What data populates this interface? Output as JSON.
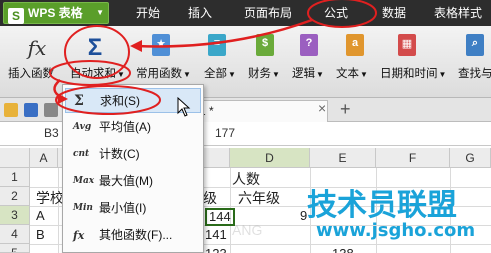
{
  "app": {
    "name": "WPS 表格",
    "logo": "S"
  },
  "menu": {
    "tabs": [
      "开始",
      "插入",
      "页面布局",
      "公式",
      "数据",
      "表格样式"
    ],
    "active": "公式"
  },
  "ribbon": {
    "buttons": [
      {
        "id": "insert-func",
        "label": "插入函数",
        "icon": "fx"
      },
      {
        "id": "autosum",
        "label": "自动求和",
        "icon": "Σ"
      },
      {
        "id": "common",
        "label": "常用函数"
      },
      {
        "id": "all",
        "label": "全部"
      },
      {
        "id": "finance",
        "label": "财务",
        "icon": "$"
      },
      {
        "id": "logic",
        "label": "逻辑",
        "icon": "?"
      },
      {
        "id": "text",
        "label": "文本",
        "icon": "a"
      },
      {
        "id": "datetime",
        "label": "日期和时间"
      },
      {
        "id": "lookup",
        "label": "查找与"
      }
    ]
  },
  "tabs_row": {
    "doc_tab": "x1 *",
    "plus": "+"
  },
  "formula_bar": {
    "cell_ref": "B3",
    "value": "177"
  },
  "grid": {
    "columns": [
      "A",
      "B",
      "C",
      "D",
      "E",
      "F",
      "G"
    ],
    "rows": [
      "1",
      "2",
      "3",
      "4",
      "5"
    ],
    "cells": {
      "a2": "学校",
      "a3": "A",
      "a4": "B",
      "c2": "级",
      "c3": "144",
      "c4": "141",
      "c5": "123",
      "d1": "人数",
      "d2": "六年级",
      "d3": "9",
      "e5": "138"
    }
  },
  "dropdown": {
    "items": [
      {
        "icon": "Σ",
        "label": "求和(S)"
      },
      {
        "icon": "Avg",
        "label": "平均值(A)"
      },
      {
        "icon": "cnt",
        "label": "计数(C)"
      },
      {
        "icon": "Max",
        "label": "最大值(M)"
      },
      {
        "icon": "Min",
        "label": "最小值(I)"
      },
      {
        "icon": "fx",
        "label": "其他函数(F)..."
      }
    ]
  },
  "watermark": {
    "title": "技术员联盟",
    "url": "www.jsgho.com",
    "faint": "联网",
    "faint2": "ANG"
  },
  "colors": {
    "accent_green": "#5a9e2a",
    "highlight_red": "#e02020",
    "dark_bar": "#2d2d2d",
    "watermark_blue": "#1aa3d9"
  }
}
